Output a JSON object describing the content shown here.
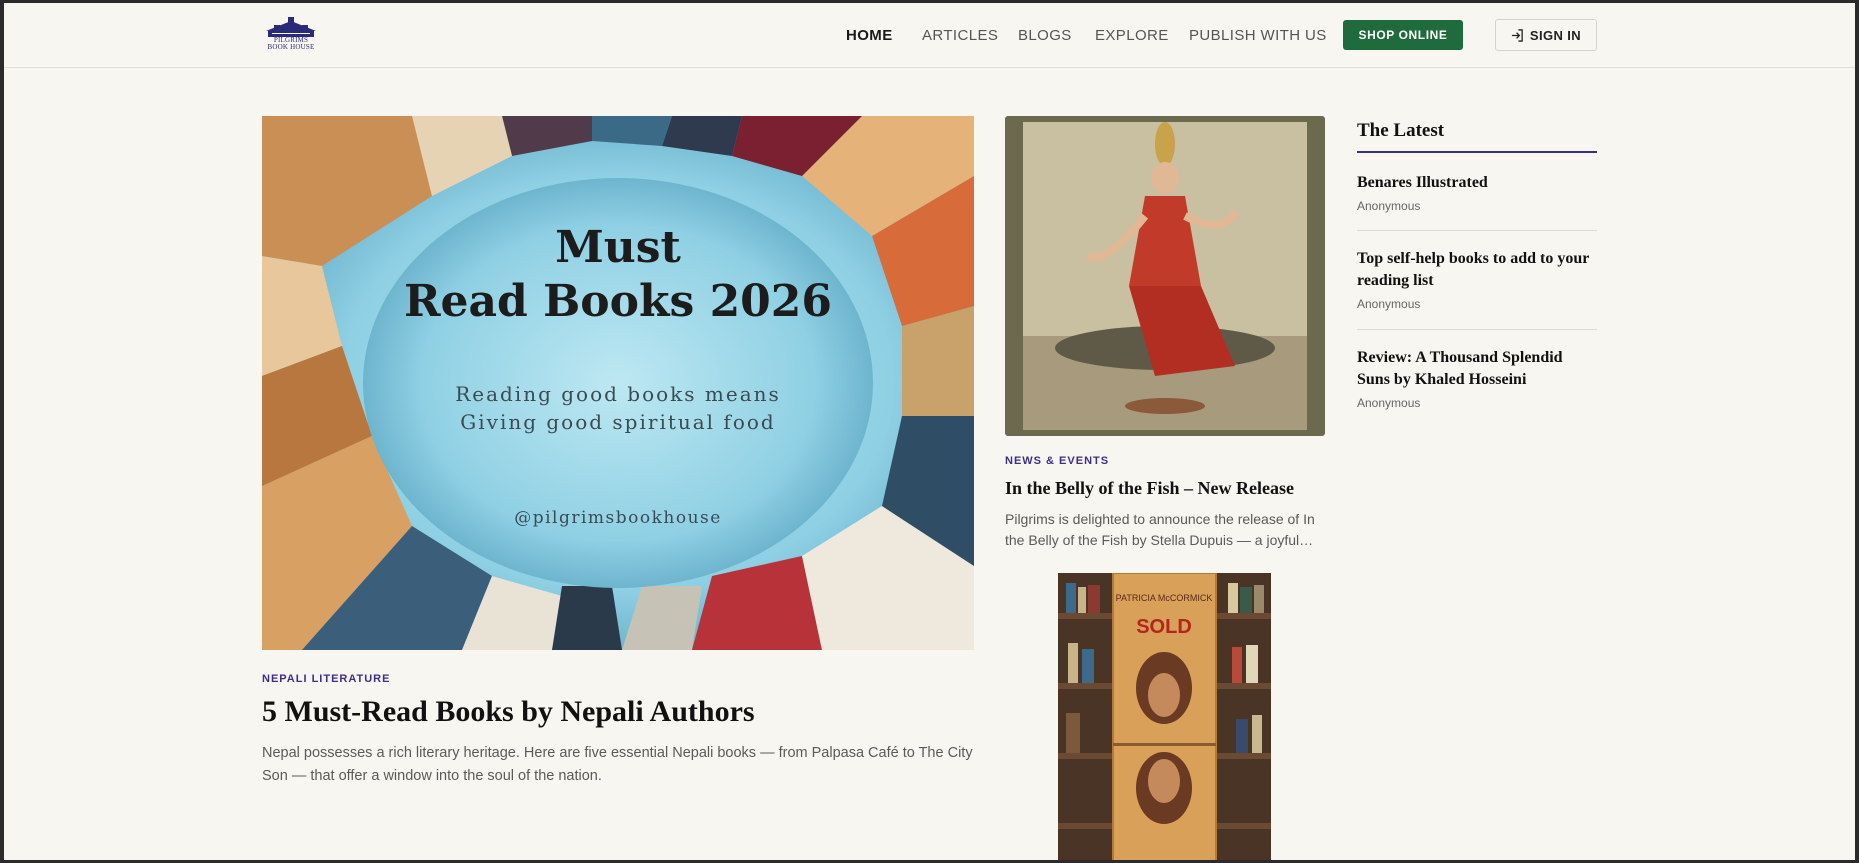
{
  "header": {
    "logo_text": "PILGRIMS BOOK HOUSE",
    "nav": [
      "HOME",
      "ARTICLES",
      "BLOGS",
      "EXPLORE",
      "PUBLISH WITH US"
    ],
    "shop_label": "SHOP ONLINE",
    "signin_label": "SIGN IN"
  },
  "hero": {
    "image_title_line1": "Must",
    "image_title_line2": "Read Books 2026",
    "image_sub_line1": "Reading good books means",
    "image_sub_line2": "Giving good spiritual food",
    "image_handle": "@pilgrimsbookhouse",
    "category": "NEPALI LITERATURE",
    "title": "5 Must-Read Books by Nepali Authors",
    "description": "Nepal possesses a rich literary heritage. Here are five essential Nepali books — from Palpasa Café to The City Son — that offer a window into the soul of the nation."
  },
  "middle": {
    "category": "NEWS & EVENTS",
    "title": "In the Belly of the Fish – New Release",
    "description": "Pilgrims is delighted to announce the release of In the Belly of the Fish by Stella Dupuis — a joyful celebration of storytelling.",
    "book_author": "PATRICIA McCORMICK",
    "book_title": "SOLD"
  },
  "sidebar": {
    "heading": "The Latest",
    "items": [
      {
        "title": "Benares Illustrated",
        "author": "Anonymous"
      },
      {
        "title": "Top self-help books to add to your reading list",
        "author": "Anonymous"
      },
      {
        "title": "Review: A Thousand Splendid Suns by Khaled Hosseini",
        "author": "Anonymous"
      }
    ]
  },
  "colors": {
    "accent": "#3b2f8a",
    "shop_green": "#1f6b3d",
    "background": "#f8f6f1"
  }
}
